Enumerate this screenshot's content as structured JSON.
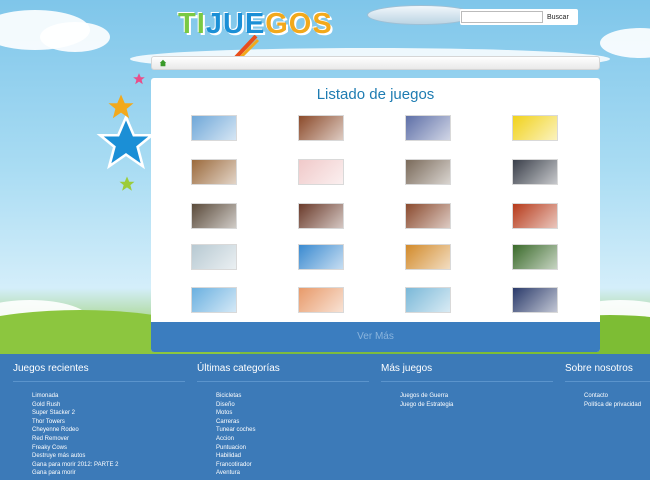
{
  "header": {
    "logo": {
      "part1": "TI",
      "part2": "JUE",
      "part3": "GOS"
    },
    "search": {
      "placeholder": "",
      "button_label": "Buscar"
    }
  },
  "colors": {
    "accent": "#1e7cb2",
    "footer": "#3c7ab8",
    "more_bar": "#3b7dbf"
  },
  "nav": {
    "home_icon": "home-icon"
  },
  "main": {
    "title": "Listado de juegos",
    "more_label": "Ver Más",
    "thumbnails": [
      {
        "row": 0,
        "col": 0,
        "color": "#6fa7d8"
      },
      {
        "row": 0,
        "col": 1,
        "color": "#8b4a2a"
      },
      {
        "row": 0,
        "col": 2,
        "color": "#5e6fa7"
      },
      {
        "row": 0,
        "col": 3,
        "color": "#f1d21b"
      },
      {
        "row": 1,
        "col": 0,
        "color": "#9b6a3c"
      },
      {
        "row": 1,
        "col": 1,
        "color": "#f0c9c9"
      },
      {
        "row": 1,
        "col": 2,
        "color": "#7a6a5a"
      },
      {
        "row": 1,
        "col": 3,
        "color": "#3a3f4a"
      },
      {
        "row": 2,
        "col": 0,
        "color": "#5a4a3a"
      },
      {
        "row": 2,
        "col": 1,
        "color": "#6a3a2a"
      },
      {
        "row": 2,
        "col": 2,
        "color": "#8a4a2e"
      },
      {
        "row": 2,
        "col": 3,
        "color": "#b63a1a"
      },
      {
        "row": 3,
        "col": 0,
        "color": "#b7c9d2"
      },
      {
        "row": 3,
        "col": 1,
        "color": "#3a8ad0"
      },
      {
        "row": 3,
        "col": 2,
        "color": "#d28a2a"
      },
      {
        "row": 3,
        "col": 3,
        "color": "#3a6a2a"
      },
      {
        "row": 4,
        "col": 0,
        "color": "#6ab0e0"
      },
      {
        "row": 4,
        "col": 1,
        "color": "#e89a6a"
      },
      {
        "row": 4,
        "col": 2,
        "color": "#7ab8d8"
      },
      {
        "row": 4,
        "col": 3,
        "color": "#2a3a6a"
      }
    ]
  },
  "footer": {
    "recent": {
      "title": "Juegos recientes",
      "items": [
        "Limonada",
        "Gold Rush",
        "Super Stacker 2",
        "Thor Towers",
        "Cheyenne Rodeo",
        "Red Remover",
        "Freaky Cows",
        "Destruye más autos",
        "Gana para morir 2012: PARTE 2",
        "Gana para morir"
      ]
    },
    "categories": {
      "title": "Últimas categorías",
      "items": [
        "Bicicletas",
        "Diseño",
        "Motos",
        "Carreras",
        "Tunear coches",
        "Accion",
        "Puntuacion",
        "Habilidad",
        "Francotirador",
        "Aventura"
      ]
    },
    "more_games": {
      "title": "Más juegos",
      "items": [
        "Juegos de Guerra",
        "Juego de Estrategia"
      ]
    },
    "about": {
      "title": "Sobre nosotros",
      "items": [
        "Contacto",
        "Política de privacidad"
      ]
    }
  }
}
